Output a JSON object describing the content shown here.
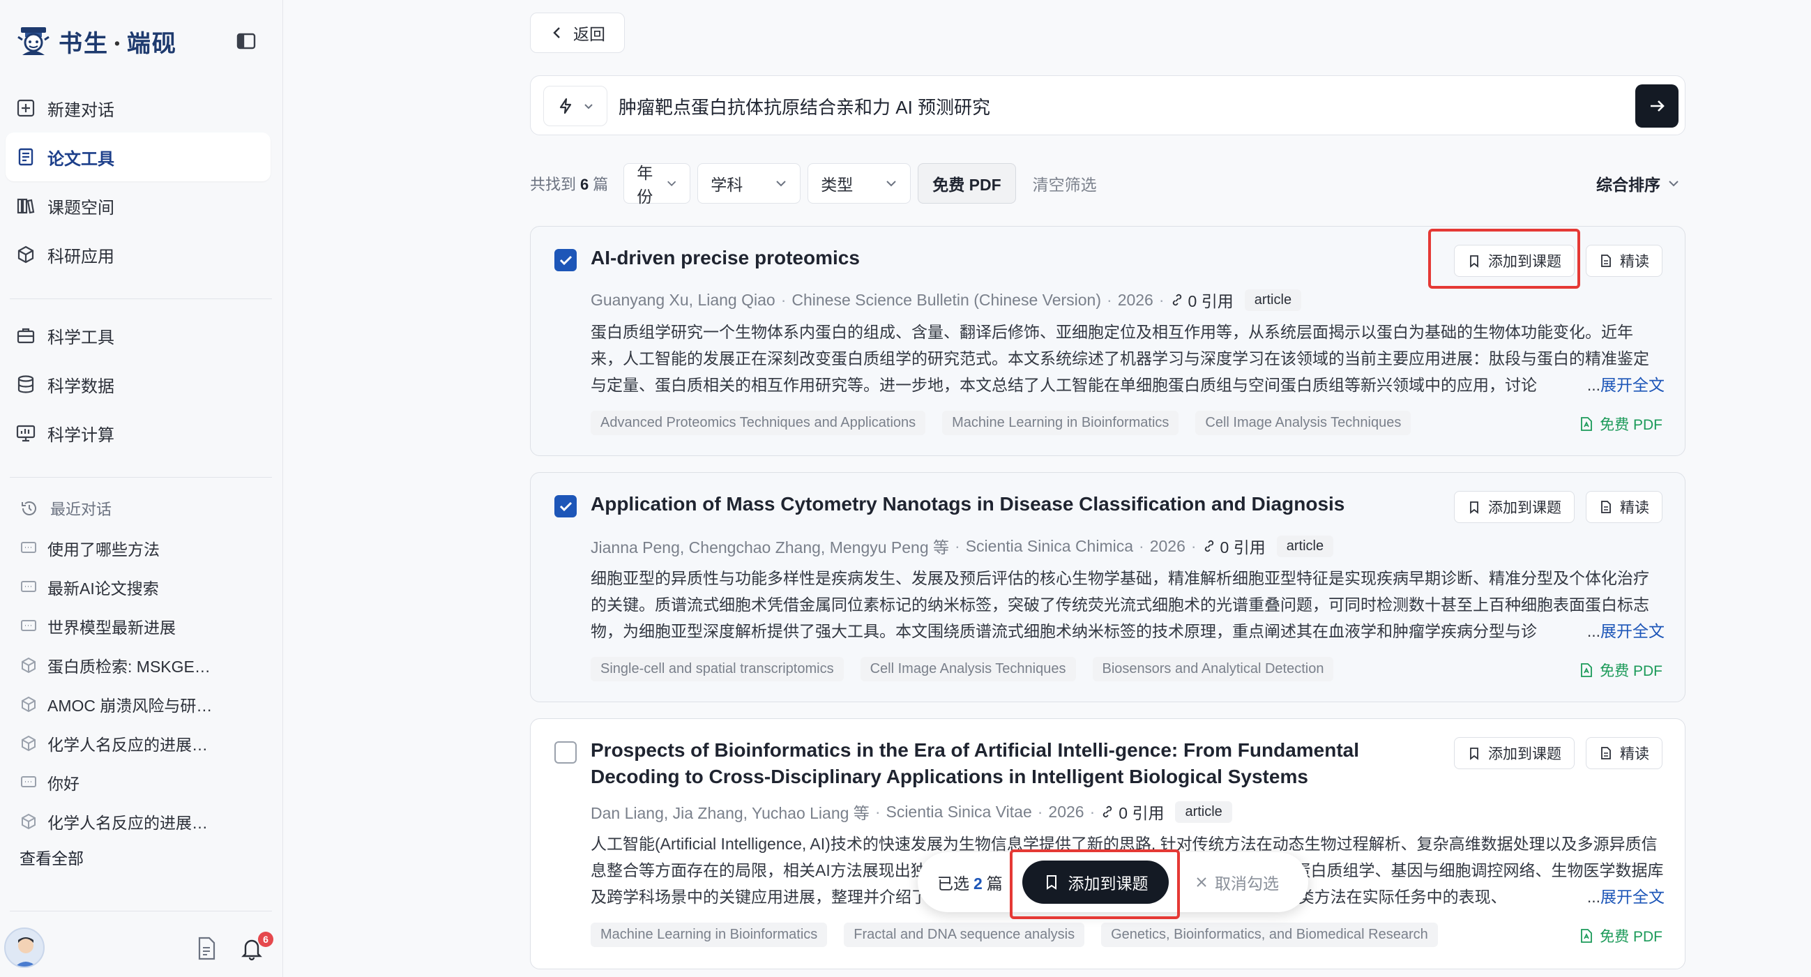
{
  "brand": {
    "name": "书生",
    "sub": "端砚",
    "dot": "·"
  },
  "sidebar": {
    "nav_main": [
      {
        "label": "新建对话",
        "icon": "plus-square-icon"
      },
      {
        "label": "论文工具",
        "icon": "document-icon",
        "active": true
      },
      {
        "label": "课题空间",
        "icon": "books-icon"
      },
      {
        "label": "科研应用",
        "icon": "cube-icon"
      }
    ],
    "nav_science": [
      {
        "label": "科学工具",
        "icon": "toolbox-icon"
      },
      {
        "label": "科学数据",
        "icon": "database-icon"
      },
      {
        "label": "科学计算",
        "icon": "monitor-chart-icon"
      }
    ],
    "recent_title": "最近对话",
    "recent": [
      {
        "label": "使用了哪些方法",
        "icon": "chat-icon"
      },
      {
        "label": "最新AI论文搜索",
        "icon": "chat-icon"
      },
      {
        "label": "世界模型最新进展",
        "icon": "chat-icon"
      },
      {
        "label": "蛋白质检索: MSKGE…",
        "icon": "cube-icon"
      },
      {
        "label": "AMOC 崩溃风险与研…",
        "icon": "cube-icon"
      },
      {
        "label": "化学人名反应的进展…",
        "icon": "cube-icon"
      },
      {
        "label": "你好",
        "icon": "chat-icon"
      },
      {
        "label": "化学人名反应的进展…",
        "icon": "cube-icon"
      }
    ],
    "view_all": "查看全部",
    "notification_count": "6"
  },
  "main": {
    "back_label": "返回",
    "search": {
      "value": "肿瘤靶点蛋白抗体抗原结合亲和力 AI 预测研究"
    },
    "filters": {
      "found_prefix": "共找到",
      "found_count": "6",
      "found_suffix": "篇",
      "year": "年份",
      "subject": "学科",
      "type": "类型",
      "free_pdf": "免费 PDF",
      "clear": "清空筛选",
      "sort": "综合排序"
    },
    "card_actions": {
      "add": "添加到课题",
      "read": "精读",
      "free_pdf": "免费 PDF",
      "expand": "展开全文",
      "ellipsis": "..."
    },
    "papers": [
      {
        "title": "AI-driven precise proteomics",
        "authors": "Guanyang Xu, Liang Qiao",
        "journal": "Chinese Science Bulletin (Chinese Version)",
        "year": "2026",
        "citations": "0 引用",
        "type": "article",
        "checked": true,
        "abstract": "蛋白质组学研究一个生物体系内蛋白的组成、含量、翻译后修饰、亚细胞定位及相互作用等，从系统层面揭示以蛋白为基础的生物体功能变化。近年来，人工智能的发展正在深刻改变蛋白质组学的研究范式。本文系统综述了机器学习与深度学习在该领域的当前主要应用进展：肽段与蛋白的精准鉴定与定量、蛋白质相关的相互作用研究等。进一步地，本文总结了人工智能在单细胞蛋白质组与空间蛋白质组等新兴领域中的应用，讨论",
        "tags": [
          "Advanced Proteomics Techniques and Applications",
          "Machine Learning in Bioinformatics",
          "Cell Image Analysis Techniques"
        ]
      },
      {
        "title": "Application of Mass Cytometry Nanotags in Disease Classification and Diagnosis",
        "authors": "Jianna Peng, Chengchao Zhang, Mengyu Peng 等",
        "journal": "Scientia Sinica Chimica",
        "year": "2026",
        "citations": "0 引用",
        "type": "article",
        "checked": true,
        "abstract": "细胞亚型的异质性与功能多样性是疾病发生、发展及预后评估的核心生物学基础，精准解析细胞亚型特征是实现疾病早期诊断、精准分型及个体化治疗的关键。质谱流式细胞术凭借金属同位素标记的纳米标签，突破了传统荧光流式细胞术的光谱重叠问题，可同时检测数十甚至上百种细胞表面蛋白标志物，为细胞亚型深度解析提供了强大工具。本文围绕质谱流式细胞术纳米标签的技术原理，重点阐述其在血液学和肿瘤学疾病分型与诊",
        "tags": [
          "Single-cell and spatial transcriptomics",
          "Cell Image Analysis Techniques",
          "Biosensors and Analytical Detection"
        ]
      },
      {
        "title": "Prospects of Bioinformatics in the Era of Artificial Intelli-gence: From Fundamental Decoding to Cross-Disciplinary Applications in Intelligent Biological Systems",
        "authors": "Dan Liang, Jia Zhang, Yuchao Liang 等",
        "journal": "Scientia Sinica Vitae",
        "year": "2026",
        "citations": "0 引用",
        "type": "article",
        "checked": false,
        "abstract": "人工智能(Artificial Intelligence, AI)技术的快速发展为生物信息学提供了新的思路, 针对传统方法在动态生物过程解析、复杂高维数据处理以及多源异质信息整合等方面存在的局限，相关AI方法展现出独特优势。本文系统梳理了AI在基因组学、转录组学、蛋白质组学、基因与细胞调控网络、生物医学数据库及跨学科场景中的关键应用进展，整理并介绍了80余种代表性方法与工具，并结合具体案例分析了各类方法在实际任务中的表现、",
        "tags": [
          "Machine Learning in Bioinformatics",
          "Fractal and DNA sequence analysis",
          "Genetics, Bioinformatics, and Biomedical Research"
        ]
      }
    ],
    "selection_bar": {
      "prefix": "已选",
      "count": "2",
      "suffix": "篇",
      "add": "添加到课题",
      "cancel": "取消勾选"
    }
  },
  "colors": {
    "accent": "#1d56b8",
    "highlight": "#e53935",
    "pdf_green": "#1b9a59",
    "dark_button": "#141a24"
  }
}
